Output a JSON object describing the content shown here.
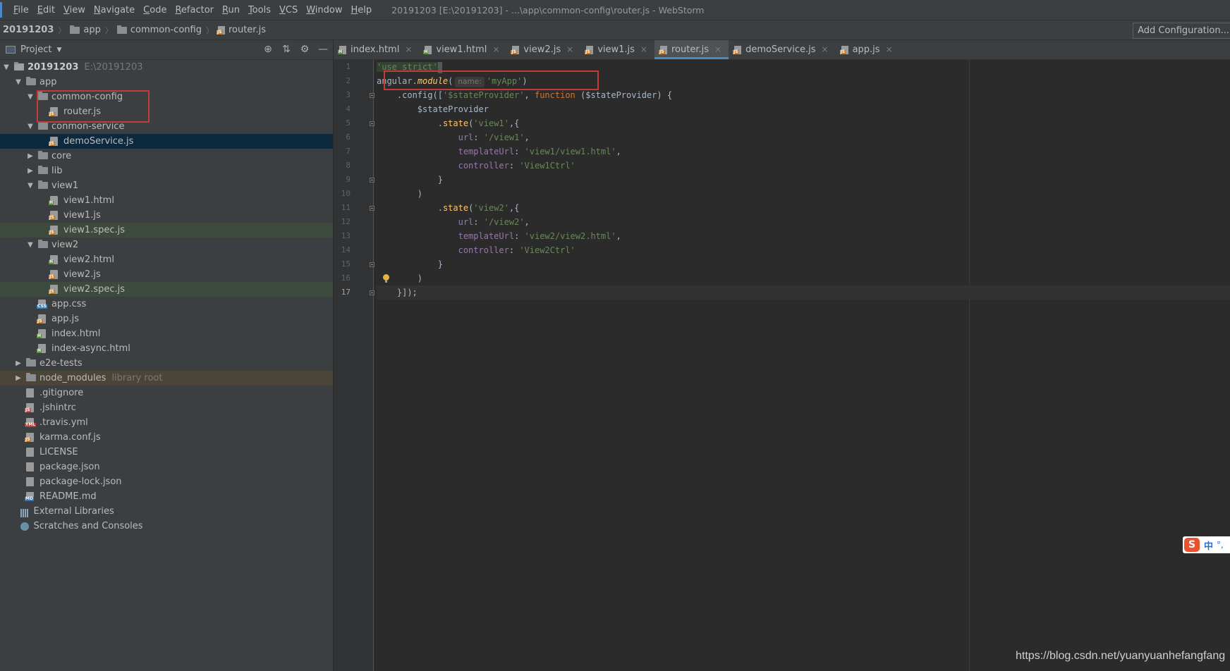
{
  "menubar": {
    "items": [
      "File",
      "Edit",
      "View",
      "Navigate",
      "Code",
      "Refactor",
      "Run",
      "Tools",
      "VCS",
      "Window",
      "Help"
    ],
    "window_title": "20191203 [E:\\20191203] - ...\\app\\common-config\\router.js - WebStorm"
  },
  "breadcrumb": {
    "project": "20191203",
    "items": [
      "app",
      "common-config",
      "router.js"
    ]
  },
  "run_config": {
    "label": "Add Configuration..."
  },
  "project_panel": {
    "title": "Project",
    "tree": [
      {
        "label": "20191203",
        "sub": "E:\\20191203",
        "icon": "folder-icon"
      },
      {
        "label": "app",
        "icon": "folder-icon"
      },
      {
        "label": "common-config",
        "icon": "folder-icon"
      },
      {
        "label": "router.js",
        "icon": "js-file-icon"
      },
      {
        "label": "conmon-service",
        "icon": "folder-icon"
      },
      {
        "label": "demoService.js",
        "icon": "js-file-icon"
      },
      {
        "label": "core",
        "icon": "folder-icon"
      },
      {
        "label": "lib",
        "icon": "folder-icon"
      },
      {
        "label": "view1",
        "icon": "folder-icon"
      },
      {
        "label": "view1.html",
        "icon": "html-file-icon"
      },
      {
        "label": "view1.js",
        "icon": "js-file-icon"
      },
      {
        "label": "view1.spec.js",
        "icon": "js-file-icon"
      },
      {
        "label": "view2",
        "icon": "folder-icon"
      },
      {
        "label": "view2.html",
        "icon": "html-file-icon"
      },
      {
        "label": "view2.js",
        "icon": "js-file-icon"
      },
      {
        "label": "view2.spec.js",
        "icon": "js-file-icon"
      },
      {
        "label": "app.css",
        "icon": "css-file-icon"
      },
      {
        "label": "app.js",
        "icon": "js-file-icon"
      },
      {
        "label": "index.html",
        "icon": "html-file-icon"
      },
      {
        "label": "index-async.html",
        "icon": "html-file-icon"
      },
      {
        "label": "e2e-tests",
        "icon": "folder-icon"
      },
      {
        "label": "node_modules",
        "sub": "library root",
        "icon": "folder-icon"
      },
      {
        "label": ".gitignore",
        "icon": "text-file-icon"
      },
      {
        "label": ".jshintrc",
        "icon": "js-file-icon"
      },
      {
        "label": ".travis.yml",
        "icon": "yml-file-icon"
      },
      {
        "label": "karma.conf.js",
        "icon": "js-file-icon"
      },
      {
        "label": "LICENSE",
        "icon": "text-file-icon"
      },
      {
        "label": "package.json",
        "icon": "json-file-icon"
      },
      {
        "label": "package-lock.json",
        "icon": "json-file-icon"
      },
      {
        "label": "README.md",
        "icon": "md-file-icon"
      },
      {
        "label": "External Libraries",
        "icon": "library-icon"
      },
      {
        "label": "Scratches and Consoles",
        "icon": "scratch-icon"
      }
    ]
  },
  "tabs": [
    {
      "label": "index.html",
      "type": "html"
    },
    {
      "label": "view1.html",
      "type": "html"
    },
    {
      "label": "view2.js",
      "type": "js"
    },
    {
      "label": "view1.js",
      "type": "js"
    },
    {
      "label": "router.js",
      "type": "js",
      "active": true
    },
    {
      "label": "demoService.js",
      "type": "js"
    },
    {
      "label": "app.js",
      "type": "js"
    }
  ],
  "file_type_tags": {
    "js": "JS",
    "html": "H",
    "css": "CSS",
    "yml": "YML",
    "md": "MD"
  },
  "editor": {
    "line_numbers": [
      "1",
      "2",
      "3",
      "4",
      "5",
      "6",
      "7",
      "8",
      "9",
      "10",
      "11",
      "12",
      "13",
      "14",
      "15",
      "16",
      "17"
    ],
    "param_hint": "name:",
    "tokens": {
      "use_strict": "'use strict'",
      "angular": "angular",
      "dot": ".",
      "module": "module",
      "open_paren": "(",
      "myapp": "'myApp'",
      "close_paren": ")",
      "config": ".config([",
      "stateprovider_str": "'$stateProvider'",
      "comma_sp": ", ",
      "function_kw": "function",
      "fn_args": " ($stateProvider) {",
      "stateprovider": "$stateProvider",
      "state": "state",
      "dot_state": ".",
      "view1_str": "'view1'",
      "view2_str": "'view2'",
      "brace_open": ",{",
      "url_key": "url",
      "colon": ": ",
      "url1": "'/view1'",
      "url2": "'/view2'",
      "comma": ",",
      "tpl_key": "templateUrl",
      "tpl1": "'view1/view1.html'",
      "tpl2": "'view2/view2.html'",
      "ctrl_key": "controller",
      "ctrl1": "'View1Ctrl'",
      "ctrl2": "'View2Ctrl'",
      "brace_close": "}",
      "paren_close": ")",
      "end": "}]);"
    }
  },
  "ime": {
    "logo": "S",
    "lang": "中",
    "extra": "°,"
  },
  "watermark": "https://blog.csdn.net/yuanyuanhefangfang"
}
